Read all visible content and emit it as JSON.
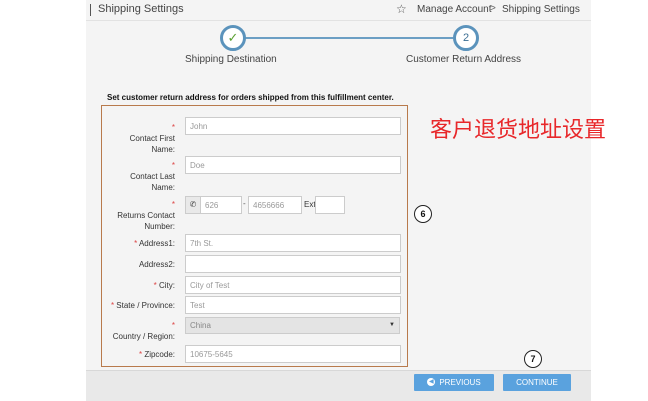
{
  "header": {
    "title": "Shipping Settings",
    "breadcrumb": [
      "Manage Account",
      "Shipping Settings"
    ],
    "separator": ">",
    "star_icon": "star-outline-icon"
  },
  "stepper": {
    "steps": [
      {
        "label": "Shipping Destination",
        "marker": "✓",
        "state": "completed"
      },
      {
        "label": "Customer Return Address",
        "marker": "2",
        "state": "current"
      }
    ]
  },
  "form": {
    "instruction": "Set customer return address for orders shipped from this fulfillment center.",
    "required_mark": "*",
    "fields": {
      "first_name": {
        "label": [
          "Contact First",
          "Name:"
        ],
        "value": "John"
      },
      "last_name": {
        "label": [
          "Contact Last",
          "Name:"
        ],
        "value": "Doe"
      },
      "phone": {
        "label": [
          "Returns Contact",
          "Number:"
        ],
        "area": "626",
        "dash": "-",
        "number": "4656666",
        "ext_label": "Ext",
        "ext": ""
      },
      "address1": {
        "label": "Address1:",
        "value": "7th St."
      },
      "address2": {
        "label": "Address2:",
        "value": ""
      },
      "city": {
        "label": "City:",
        "value": "City of Test"
      },
      "state": {
        "label": "State / Province:",
        "value": "Test"
      },
      "country": {
        "label": "Country / Region:",
        "value": "China"
      },
      "zipcode": {
        "label": "Zipcode:",
        "value": "10675-5645"
      }
    }
  },
  "annotations": {
    "cn_label": "客户退货地址设置",
    "marker_form": "6",
    "marker_continue": "7"
  },
  "buttons": {
    "previous": "PREVIOUS",
    "continue": "CONTINUE"
  },
  "colors": {
    "accent": "#5aa2de",
    "step_ring": "#5b93bc",
    "check": "#5aa031",
    "annotation_red": "#e8272a",
    "form_border": "#b87a4c"
  }
}
